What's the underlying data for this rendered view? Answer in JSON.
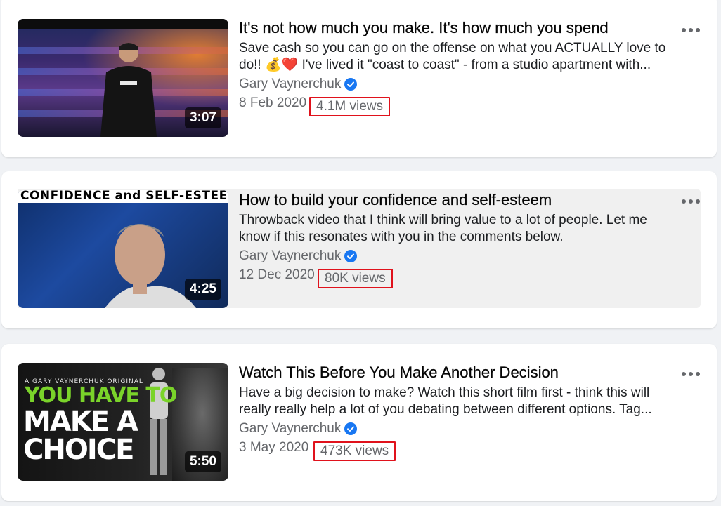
{
  "videos": [
    {
      "title": "It's not how much you make. It's how much you spend",
      "description_line1": "Save cash so you can go on the offense on what you ACTUALLY love to",
      "description_line2": "do!! 💰❤️ I've lived it \"coast to coast\" - from a studio apartment with...",
      "channel": "Gary Vaynerchuk",
      "date": "8 Feb 2020",
      "views": "4.1M views",
      "duration": "3:07"
    },
    {
      "title": "How to build your confidence and self-esteem",
      "description_line1": "Throwback video that I think will bring value to a lot of people. Let me",
      "description_line2": "know if this resonates with you in the comments below.",
      "channel": "Gary Vaynerchuk",
      "date": "12 Dec 2020",
      "views": "80K views",
      "duration": "4:25",
      "thumbnail_text": "CONFIDENCE and SELF-ESTEEM"
    },
    {
      "title": "Watch This Before You Make Another Decision",
      "description_line1": "Have a big decision to make? Watch this short film first - think this will",
      "description_line2": "really really help a lot of you debating between different options. Tag...",
      "channel": "Gary Vaynerchuk",
      "date": "3 May 2020",
      "views": "473K views",
      "duration": "5:50",
      "thumbnail_small": "A GARY VAYNERCHUK ORIGINAL",
      "thumbnail_green": "YOU HAVE TO",
      "thumbnail_white1": "MAKE A",
      "thumbnail_white2": "CHOICE"
    }
  ],
  "colors": {
    "highlight_box": "#e0121c",
    "verified_badge": "#1877f2",
    "secondary_text": "#65676b"
  },
  "icons": {
    "verified": "verified-badge-icon",
    "more": "more-options-icon"
  }
}
